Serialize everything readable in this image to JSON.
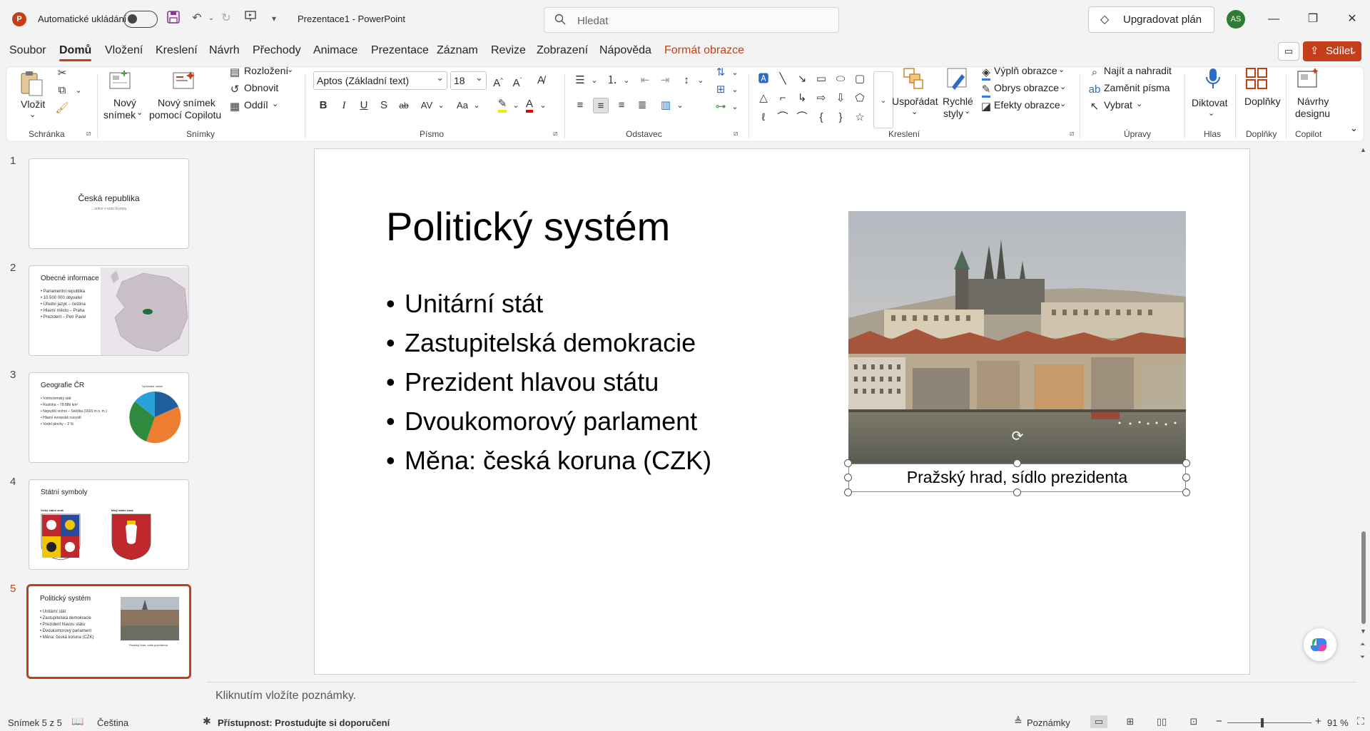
{
  "titlebar": {
    "autosave_label": "Automatické ukládání",
    "doc_title": "Prezentace1  -  PowerPoint",
    "search_placeholder": "Hledat",
    "upgrade_label": "Upgradovat plán",
    "avatar_initials": "AS"
  },
  "tabs": [
    {
      "label": "Soubor"
    },
    {
      "label": "Domů"
    },
    {
      "label": "Vložení"
    },
    {
      "label": "Kreslení"
    },
    {
      "label": "Návrh"
    },
    {
      "label": "Přechody"
    },
    {
      "label": "Animace"
    },
    {
      "label": "Prezentace"
    },
    {
      "label": "Záznam"
    },
    {
      "label": "Revize"
    },
    {
      "label": "Zobrazení"
    },
    {
      "label": "Nápověda"
    },
    {
      "label": "Formát obrazce"
    }
  ],
  "share_label": "Sdílet",
  "ribbon": {
    "groups": {
      "clipboard": "Schránka",
      "slides": "Snímky",
      "font": "Písmo",
      "paragraph": "Odstavec",
      "drawing": "Kreslení",
      "editing": "Úpravy",
      "voice": "Hlas",
      "addins": "Doplňky",
      "copilot": "Copilot"
    },
    "paste": "Vložit",
    "new_slide_line1": "Nový",
    "new_slide_line2": "snímek",
    "new_slide_copilot_line1": "Nový snímek",
    "new_slide_copilot_line2": "pomocí Copilotu",
    "layout": "Rozložení",
    "reset": "Obnovit",
    "section": "Oddíl",
    "font_name": "Aptos (Základní text)",
    "font_size": "18",
    "arrange": "Uspořádat",
    "quick_styles_line1": "Rychlé",
    "quick_styles_line2": "styly",
    "shape_fill": "Výplň obrazce",
    "shape_outline": "Obrys obrazce",
    "shape_effects": "Efekty obrazce",
    "find_replace": "Najít a nahradit",
    "replace_fonts": "Zaměnit písma",
    "select": "Vybrat",
    "dictate": "Diktovat",
    "addins": "Doplňky",
    "designer_line1": "Návrhy",
    "designer_line2": "designu"
  },
  "thumbnails": [
    {
      "num": "1",
      "title": "Česká republika",
      "subtitle": "…srdce v srdci Evropy"
    },
    {
      "num": "2",
      "title": "Obecné informace",
      "bullets": [
        "• Parlamentní republika",
        "• 10 500 000 obyvatel",
        "• Úřední jazyk – čeština",
        "• Hlavní město – Praha",
        "• Prezident – Petr Pavel"
      ]
    },
    {
      "num": "3",
      "title": "Geografie ČR",
      "chart_title": "Využívání území",
      "bullets": [
        "• Vnitrozemský stát",
        "• Rozloha – 78 886 km²",
        "• Nejvyšší vrchol – Sněžka (1603 m n. m.)",
        "• Hlavní evropské rozvodí",
        "• Vodní plochy – 2 %"
      ]
    },
    {
      "num": "4",
      "title": "Státní symboly",
      "label_big": "Velký státní znak",
      "label_small": "Malý státní znak"
    },
    {
      "num": "5",
      "title": "Politický systém",
      "bullets": [
        "• Unitární stát",
        "• Zastupitelská demokracie",
        "• Prezident hlavou státu",
        "• Dvoukomorový parlament",
        "• Měna: česká koruna (CZK)"
      ],
      "caption": "Pražský hrad, sídlo prezidenta"
    }
  ],
  "slide": {
    "title": "Politický systém",
    "bullets": [
      "Unitární stát",
      "Zastupitelská demokracie",
      "Prezident hlavou státu",
      "Dvoukomorový parlament",
      "Měna: česká koruna (CZK)"
    ],
    "caption": "Pražský hrad, sídlo prezidenta"
  },
  "notes_placeholder": "Kliknutím vložíte poznámky.",
  "status": {
    "slide_counter": "Snímek 5 z 5",
    "language": "Čeština",
    "accessibility": "Přístupnost: Prostudujte si doporučení",
    "notes": "Poznámky",
    "zoom": "91 %"
  },
  "colors": {
    "accent": "#c43e1c",
    "avatar": "#2e7d32"
  }
}
